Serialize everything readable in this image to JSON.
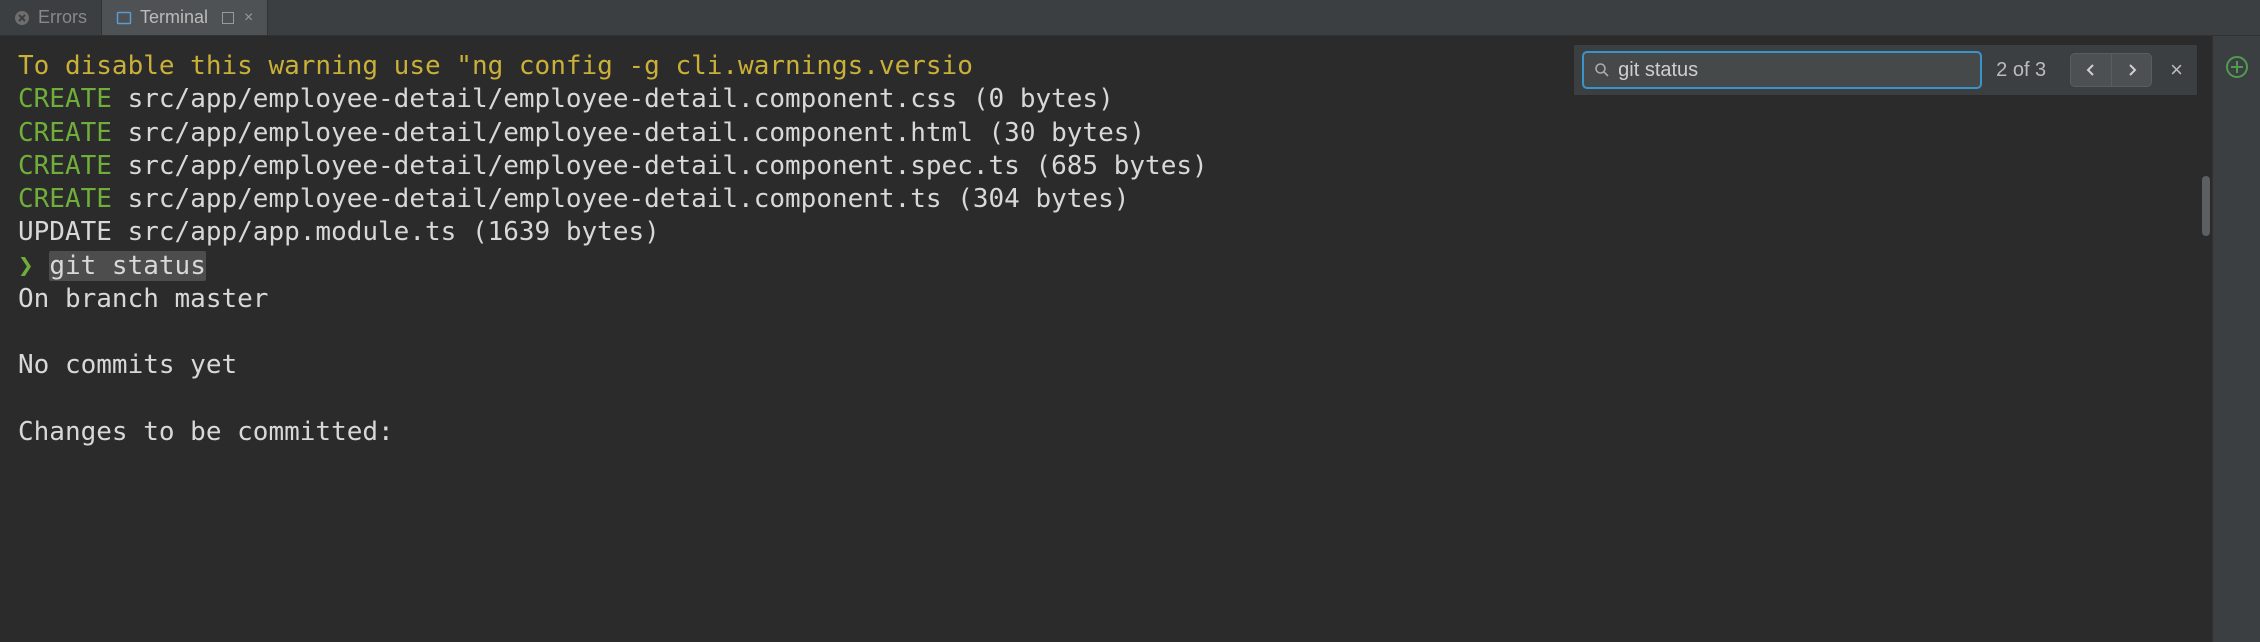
{
  "tabs": {
    "errors": {
      "label": "Errors"
    },
    "terminal": {
      "label": "Terminal"
    }
  },
  "search": {
    "value": "git status",
    "count": "2 of 3"
  },
  "terminal": {
    "warning": "To disable this warning use \"ng config -g cli.warnings.versio",
    "create_prefix": "CREATE",
    "update_prefix": "UPDATE",
    "lines": {
      "c1": " src/app/employee-detail/employee-detail.component.css (0 bytes)",
      "c2": " src/app/employee-detail/employee-detail.component.html (30 bytes)",
      "c3": " src/app/employee-detail/employee-detail.component.spec.ts (685 bytes)",
      "c4": " src/app/employee-detail/employee-detail.component.ts (304 bytes)",
      "u1": " src/app/app.module.ts (1639 bytes)"
    },
    "prompt_symbol": "❯",
    "prompt_cmd": "git status",
    "out1": "On branch master",
    "out2": "No commits yet",
    "out3": "Changes to be committed:"
  }
}
